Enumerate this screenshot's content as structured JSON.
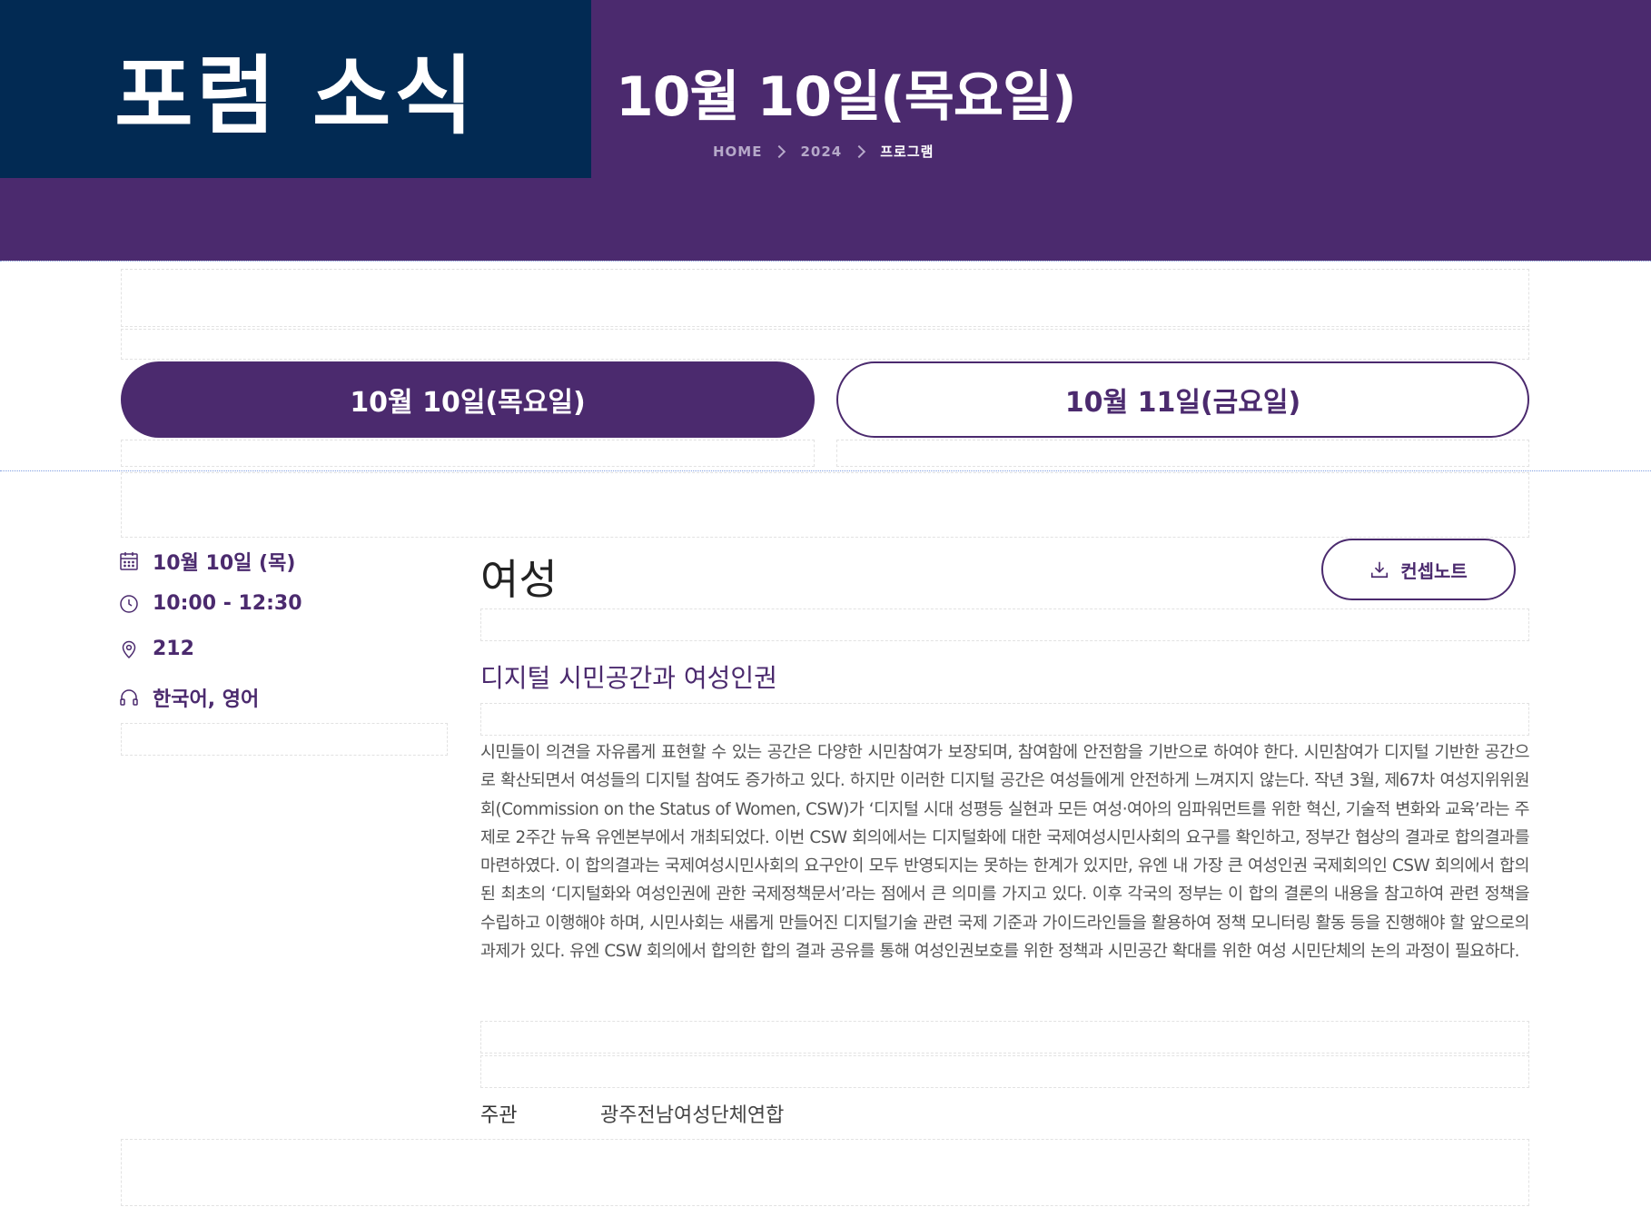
{
  "header": {
    "badge": "포럼 소식",
    "title": "10월 10일(목요일)",
    "breadcrumb": [
      "HOME",
      "2024",
      "프로그램"
    ]
  },
  "tabs": [
    {
      "label": "10월 10일(목요일)",
      "active": true
    },
    {
      "label": "10월 11일(금요일)",
      "active": false
    }
  ],
  "session": {
    "date": "10월 10일 (목)",
    "time": "10:00 - 12:30",
    "room": "212",
    "languages": "한국어, 영어",
    "title": "여성",
    "concept_note_label": "컨셉노트",
    "subtitle": "디지털 시민공간과 여성인권",
    "description": "시민들이 의견을 자유롭게 표현할 수 있는 공간은 다양한 시민참여가 보장되며, 참여함에 안전함을 기반으로 하여야 한다. 시민참여가 디지털 기반한 공간으로 확산되면서 여성들의 디지털 참여도 증가하고 있다. 하지만 이러한 디지털 공간은 여성들에게 안전하게 느껴지지 않는다. 작년 3월, 제67차 여성지위위원회(Commission on the Status of Women, CSW)가 ‘디지털 시대 성평등 실현과 모든 여성·여아의 임파워먼트를 위한 혁신, 기술적 변화와 교육’라는 주제로 2주간 뉴욕 유엔본부에서 개최되었다. 이번 CSW 회의에서는 디지털화에 대한 국제여성시민사회의 요구를 확인하고, 정부간 협상의 결과로 합의결과를 마련하였다. 이 합의결과는 국제여성시민사회의 요구안이 모두 반영되지는 못하는 한계가 있지만, 유엔 내 가장 큰 여성인권 국제회의인 CSW 회의에서 합의된 최초의 ‘디지털화와 여성인권에 관한 국제정책문서’라는 점에서 큰 의미를 가지고 있다. 이후 각국의 정부는 이 합의 결론의 내용을 참고하여 관련 정책을 수립하고 이행해야 하며, 시민사회는 새롭게 만들어진 디지털기술 관련 국제 기준과 가이드라인들을 활용하여 정책 모니터링 활동 등을 진행해야 할 앞으로의 과제가 있다. 유엔 CSW 회의에서 합의한 합의 결과 공유를 통해 여성인권보호를 위한 정책과 시민공간 확대를 위한 여성 시민단체의 논의 과정이 필요하다.",
    "host_label": "주관",
    "host_value": "광주전남여성단체연합"
  },
  "icons": {
    "date": "calendar-icon",
    "time": "clock-icon",
    "room": "location-pin-icon",
    "languages": "headphones-icon",
    "concept_note": "download-icon",
    "breadcrumb_separator": "chevron-right-icon"
  },
  "colors": {
    "hero_purple": "#4b2a6e",
    "badge_navy": "#022a53",
    "accent": "#4b2a6e"
  }
}
